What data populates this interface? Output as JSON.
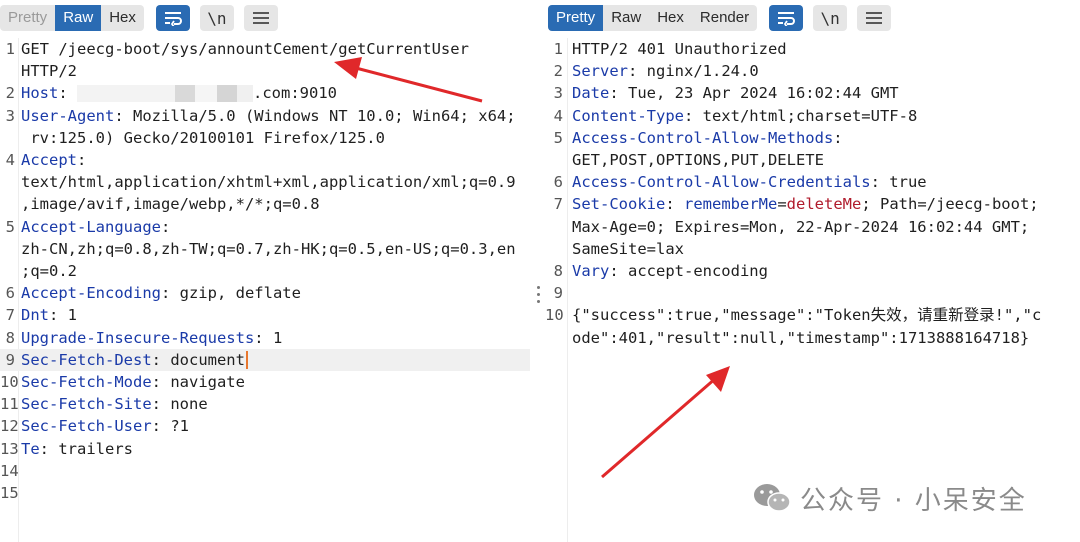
{
  "request": {
    "tabs": [
      {
        "label": "Pretty",
        "active": false,
        "dim": true
      },
      {
        "label": "Raw",
        "active": true,
        "dim": false
      },
      {
        "label": "Hex",
        "active": false,
        "dim": false
      }
    ],
    "newline_label": "\\n",
    "lines": [
      {
        "num": "1",
        "parts": [
          {
            "t": "GET /jeecg-boot/sys/annountCement/getCurrentUser",
            "c": "val"
          }
        ]
      },
      {
        "num": "",
        "parts": [
          {
            "t": "HTTP/2",
            "c": "val"
          }
        ]
      },
      {
        "num": "2",
        "parts": [
          {
            "t": "Host",
            "c": "key"
          },
          {
            "t": ": ",
            "c": "val"
          },
          {
            "mask": true
          },
          {
            "t": ".com:9010",
            "c": "val"
          }
        ]
      },
      {
        "num": "3",
        "parts": [
          {
            "t": "User-Agent",
            "c": "key"
          },
          {
            "t": ": Mozilla/5.0 (Windows NT 10.0; Win64; x64;",
            "c": "val"
          }
        ]
      },
      {
        "num": "",
        "parts": [
          {
            "t": " rv:125.0) Gecko/20100101 Firefox/125.0",
            "c": "val"
          }
        ]
      },
      {
        "num": "4",
        "parts": [
          {
            "t": "Accept",
            "c": "key"
          },
          {
            "t": ":",
            "c": "val"
          }
        ]
      },
      {
        "num": "",
        "parts": [
          {
            "t": "text/html,application/xhtml+xml,application/xml;q=0.9",
            "c": "val"
          }
        ]
      },
      {
        "num": "",
        "parts": [
          {
            "t": ",image/avif,image/webp,*/*;q=0.8",
            "c": "val"
          }
        ]
      },
      {
        "num": "5",
        "parts": [
          {
            "t": "Accept-Language",
            "c": "key"
          },
          {
            "t": ":",
            "c": "val"
          }
        ]
      },
      {
        "num": "",
        "parts": [
          {
            "t": "zh-CN,zh;q=0.8,zh-TW;q=0.7,zh-HK;q=0.5,en-US;q=0.3,en",
            "c": "val"
          }
        ]
      },
      {
        "num": "",
        "parts": [
          {
            "t": ";q=0.2",
            "c": "val"
          }
        ]
      },
      {
        "num": "6",
        "parts": [
          {
            "t": "Accept-Encoding",
            "c": "key"
          },
          {
            "t": ": gzip, deflate",
            "c": "val"
          }
        ]
      },
      {
        "num": "7",
        "parts": [
          {
            "t": "Dnt",
            "c": "key"
          },
          {
            "t": ": 1",
            "c": "val"
          }
        ]
      },
      {
        "num": "8",
        "parts": [
          {
            "t": "Upgrade-Insecure-Requests",
            "c": "key"
          },
          {
            "t": ": 1",
            "c": "val"
          }
        ]
      },
      {
        "num": "9",
        "highlight": true,
        "caret": true,
        "parts": [
          {
            "t": "Sec-Fetch-Dest",
            "c": "key"
          },
          {
            "t": ": document",
            "c": "val"
          }
        ]
      },
      {
        "num": "10",
        "parts": [
          {
            "t": "Sec-Fetch-Mode",
            "c": "key"
          },
          {
            "t": ": navigate",
            "c": "val"
          }
        ]
      },
      {
        "num": "11",
        "parts": [
          {
            "t": "Sec-Fetch-Site",
            "c": "key"
          },
          {
            "t": ": none",
            "c": "val"
          }
        ]
      },
      {
        "num": "12",
        "parts": [
          {
            "t": "Sec-Fetch-User",
            "c": "key"
          },
          {
            "t": ": ?1",
            "c": "val"
          }
        ]
      },
      {
        "num": "13",
        "parts": [
          {
            "t": "Te",
            "c": "key"
          },
          {
            "t": ": trailers",
            "c": "val"
          }
        ]
      },
      {
        "num": "14",
        "parts": []
      },
      {
        "num": "15",
        "parts": []
      }
    ]
  },
  "response": {
    "tabs": [
      {
        "label": "Pretty",
        "active": true,
        "dim": false
      },
      {
        "label": "Raw",
        "active": false,
        "dim": false
      },
      {
        "label": "Hex",
        "active": false,
        "dim": false
      },
      {
        "label": "Render",
        "active": false,
        "dim": false
      }
    ],
    "newline_label": "\\n",
    "lines": [
      {
        "num": "1",
        "parts": [
          {
            "t": "HTTP/2 401 Unauthorized",
            "c": "val"
          }
        ]
      },
      {
        "num": "2",
        "parts": [
          {
            "t": "Server",
            "c": "key"
          },
          {
            "t": ": nginx/1.24.0",
            "c": "val"
          }
        ]
      },
      {
        "num": "3",
        "parts": [
          {
            "t": "Date",
            "c": "key"
          },
          {
            "t": ": Tue, 23 Apr 2024 16:02:44 GMT",
            "c": "val"
          }
        ]
      },
      {
        "num": "4",
        "parts": [
          {
            "t": "Content-Type",
            "c": "key"
          },
          {
            "t": ": text/html;charset=UTF-8",
            "c": "val"
          }
        ]
      },
      {
        "num": "5",
        "parts": [
          {
            "t": "Access-Control-Allow-Methods",
            "c": "key"
          },
          {
            "t": ":",
            "c": "val"
          }
        ]
      },
      {
        "num": "",
        "parts": [
          {
            "t": "GET,POST,OPTIONS,PUT,DELETE",
            "c": "val"
          }
        ]
      },
      {
        "num": "6",
        "parts": [
          {
            "t": "Access-Control-Allow-Credentials",
            "c": "key"
          },
          {
            "t": ": true",
            "c": "val"
          }
        ]
      },
      {
        "num": "7",
        "parts": [
          {
            "t": "Set-Cookie",
            "c": "key"
          },
          {
            "t": ": ",
            "c": "val"
          },
          {
            "t": "rememberMe",
            "c": "ck"
          },
          {
            "t": "=",
            "c": "val"
          },
          {
            "t": "deleteMe",
            "c": "cv"
          },
          {
            "t": "; Path=/jeecg-boot;",
            "c": "val"
          }
        ]
      },
      {
        "num": "",
        "parts": [
          {
            "t": "Max-Age=0; Expires=Mon, 22-Apr-2024 16:02:44 GMT;",
            "c": "val"
          }
        ]
      },
      {
        "num": "",
        "parts": [
          {
            "t": "SameSite=lax",
            "c": "val"
          }
        ]
      },
      {
        "num": "8",
        "parts": [
          {
            "t": "Vary",
            "c": "key"
          },
          {
            "t": ": accept-encoding",
            "c": "val"
          }
        ]
      },
      {
        "num": "9",
        "parts": []
      },
      {
        "num": "10",
        "parts": [
          {
            "t": "{\"success\":true,\"message\":\"Token失效，请重新登录!\",\"c",
            "c": "val"
          }
        ]
      },
      {
        "num": "",
        "parts": [
          {
            "t": "ode\":401,\"result\":null,\"timestamp\":1713888164718}",
            "c": "val"
          }
        ]
      }
    ]
  },
  "watermark": {
    "text": "公众号 · 小呆安全",
    "icon": "wechat-icon"
  },
  "colors": {
    "accent": "#2a6bb3",
    "key": "#1a3aa8",
    "cookie_value": "#b01b2c",
    "arrow": "#e0282a"
  }
}
